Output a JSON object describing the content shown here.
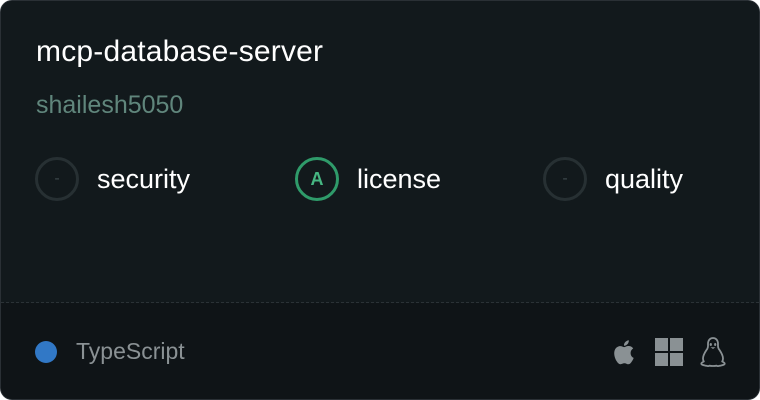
{
  "card": {
    "title": "mcp-database-server",
    "owner": "shailesh5050"
  },
  "scores": [
    {
      "label": "security",
      "grade": "-"
    },
    {
      "label": "license",
      "grade": "A"
    },
    {
      "label": "quality",
      "grade": "-"
    }
  ],
  "footer": {
    "language": "TypeScript",
    "language_color": "#3178c6",
    "platforms": [
      "apple-icon",
      "windows-icon",
      "linux-icon"
    ]
  },
  "colors": {
    "background": "#12191c",
    "grade_a": "#2f9b6a",
    "owner_text": "#60867c"
  }
}
